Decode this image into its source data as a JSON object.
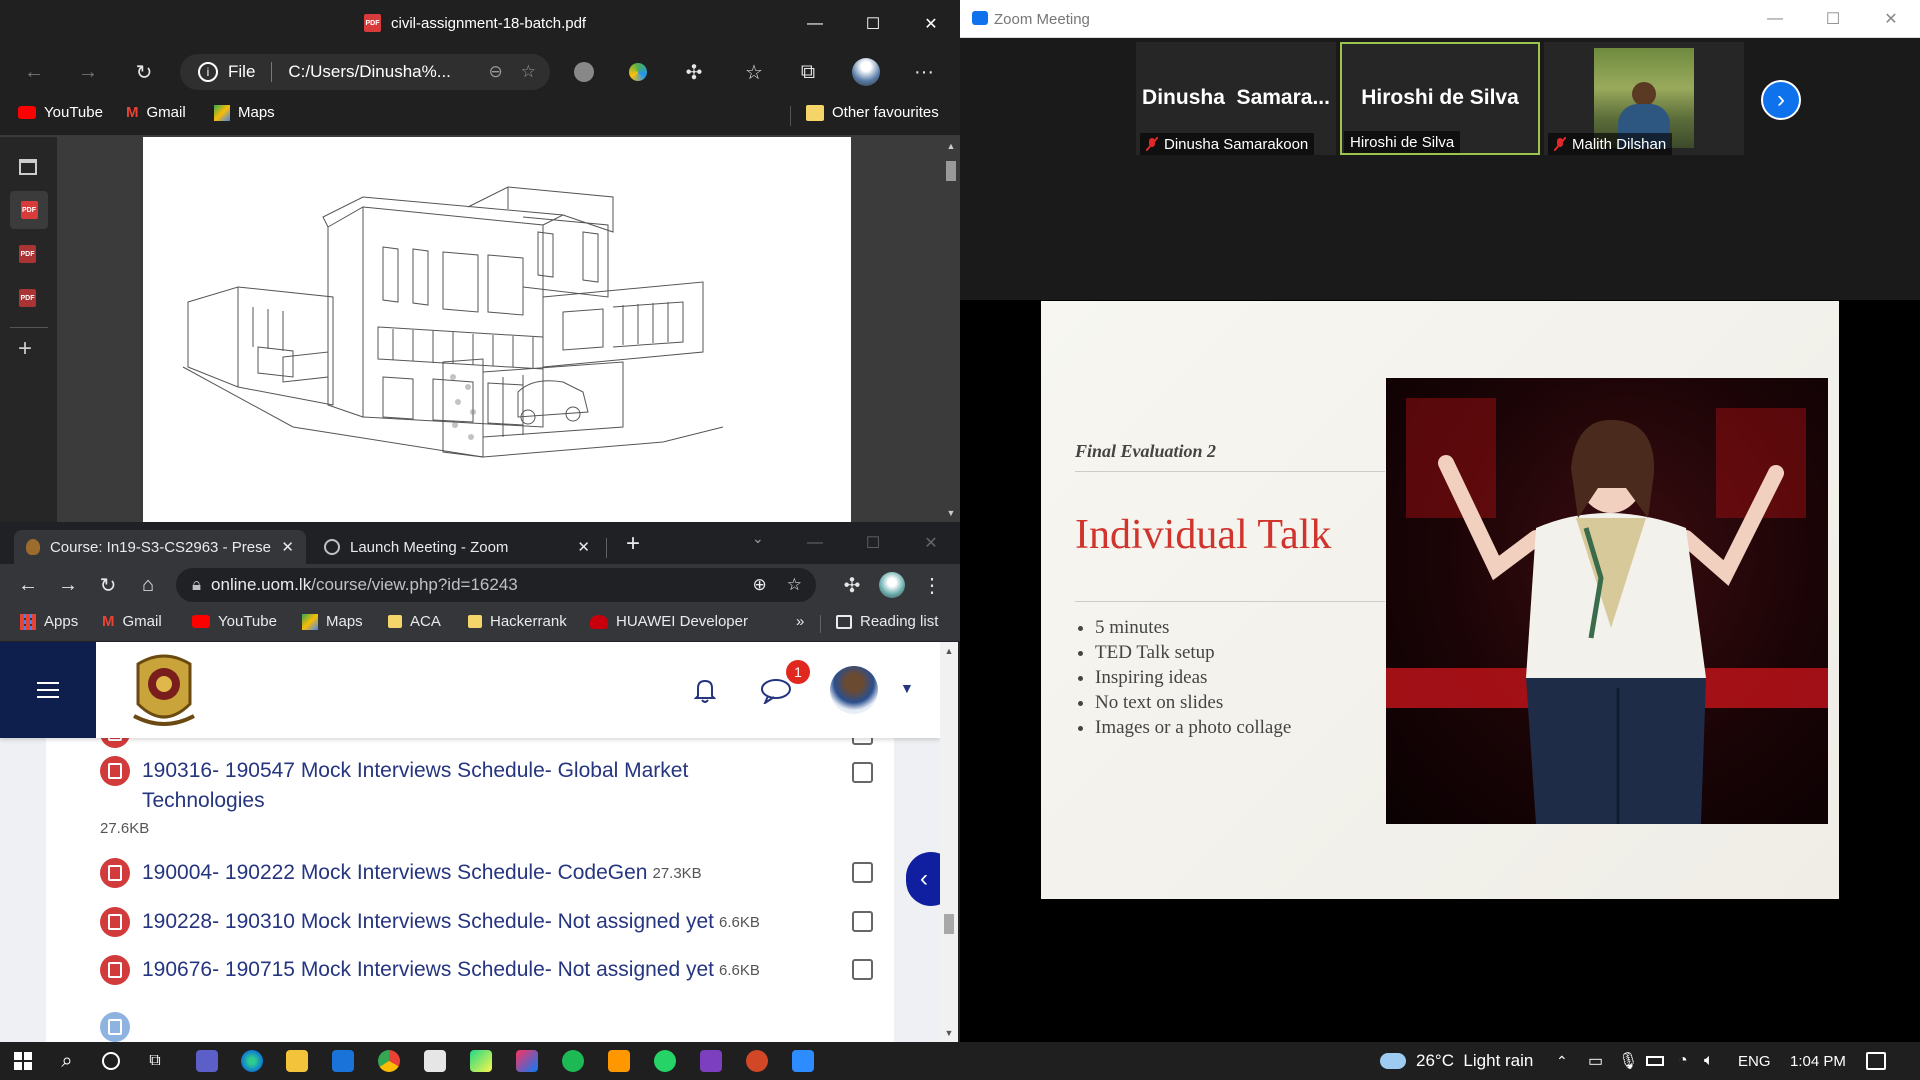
{
  "edge": {
    "title": "civil-assignment-18-batch.pdf",
    "address": "C:/Users/Dinusha%...",
    "address_prefix": "File",
    "bookmarks": [
      "YouTube",
      "Gmail",
      "Maps"
    ],
    "other_favourites": "Other favourites"
  },
  "chrome": {
    "tabs": [
      {
        "label": "Course: In19-S3-CS2963 - Presen",
        "active": true
      },
      {
        "label": "Launch Meeting - Zoom",
        "active": false
      }
    ],
    "url_host": "online.uom.lk",
    "url_path": "/course/view.php?id=16243",
    "bookmarks": [
      "Apps",
      "Gmail",
      "YouTube",
      "Maps",
      "ACA",
      "Hackerrank",
      "HUAWEI Developer"
    ],
    "more": "»",
    "reading_list": "Reading list",
    "notification_count": "1",
    "files": [
      {
        "name": "190316- 190547 Mock Interviews Schedule- Global Market Technologies",
        "line1": "190316- 190547 Mock Interviews Schedule- Global Market",
        "line2": "Technologies",
        "size": "27.6KB"
      },
      {
        "name": "190004- 190222 Mock Interviews Schedule- CodeGen",
        "size": "27.3KB"
      },
      {
        "name": "190228- 190310 Mock Interviews Schedule- Not assigned yet",
        "size": "6.6KB"
      },
      {
        "name": "190676- 190715 Mock Interviews Schedule- Not assigned yet",
        "size": "6.6KB"
      }
    ]
  },
  "zoom": {
    "window_title": "Zoom Meeting",
    "participants": [
      {
        "display": "Dinusha  Samara...",
        "label": "Dinusha Samarakoon",
        "muted": true
      },
      {
        "display": "Hiroshi de Silva",
        "label": "Hiroshi de Silva",
        "muted": false,
        "active_speaker": true
      },
      {
        "display": "",
        "label": "Malith Dilshan",
        "muted": true
      }
    ],
    "slide": {
      "subtitle": "Final Evaluation 2",
      "title": "Individual Talk",
      "bullets": [
        "5 minutes",
        "TED Talk setup",
        "Inspiring ideas",
        "No text on slides",
        "Images or a photo collage"
      ]
    }
  },
  "taskbar": {
    "weather": "26°C  Light rain",
    "language": "ENG",
    "time": "1:04 PM"
  },
  "colors": {
    "slide_title": "#d0342c",
    "link": "#25357f",
    "moodle_header": "#0f1f4d",
    "zoom_blue": "#0e72ed"
  }
}
